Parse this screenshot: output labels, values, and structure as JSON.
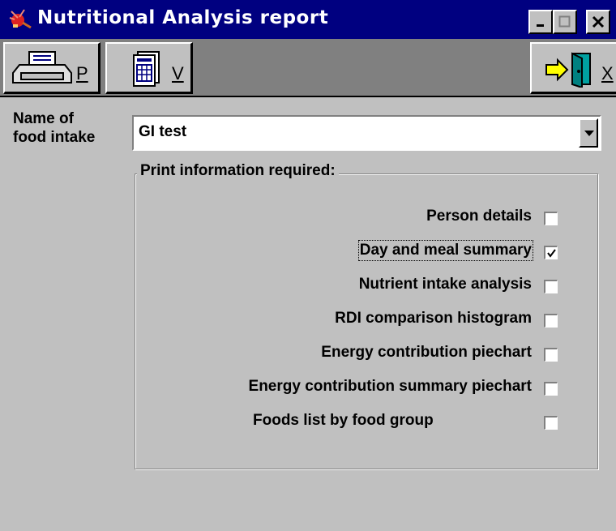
{
  "window": {
    "title": "Nutritional Analysis report"
  },
  "toolbar": {
    "print_key": "P",
    "view_key": "V",
    "exit_key": "X"
  },
  "form": {
    "name_label_line1": "Name of",
    "name_label_line2": "food intake",
    "food_intake_value": "GI test"
  },
  "print_group": {
    "legend": "Print information required:",
    "options": [
      {
        "label": "Person details",
        "checked": false
      },
      {
        "label": "Day and meal summary",
        "checked": true
      },
      {
        "label": "Nutrient intake analysis",
        "checked": false
      },
      {
        "label": "RDI comparison histogram",
        "checked": false
      },
      {
        "label": "Energy contribution piechart",
        "checked": false
      },
      {
        "label": "Energy contribution summary piechart",
        "checked": false
      },
      {
        "label": "Foods list by food group",
        "checked": false
      }
    ]
  }
}
